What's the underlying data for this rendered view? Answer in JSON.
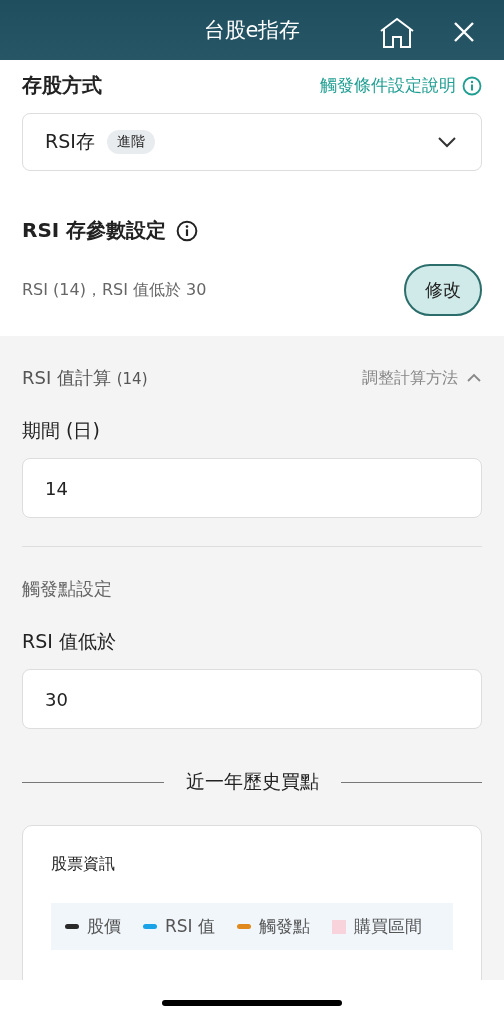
{
  "header": {
    "title": "台股e指存"
  },
  "method": {
    "label": "存股方式",
    "help_link": "觸發條件設定說明",
    "value": "RSI存",
    "badge": "進階"
  },
  "params": {
    "title": "RSI 存參數設定",
    "summary": "RSI (14)，RSI 值低於 30",
    "edit_button": "修改"
  },
  "calc": {
    "title": "RSI 值計算",
    "count": "(14)",
    "toggle": "調整計算方法",
    "expanded": true,
    "period_label": "期間 (日)",
    "period_value": "14",
    "trigger_title": "觸發點設定",
    "threshold_label": "RSI 值低於",
    "threshold_value": "30"
  },
  "history": {
    "title": "近一年歷史買點",
    "card_title": "股票資訊",
    "legend": [
      {
        "label": "股價",
        "kind": "line",
        "color": "#2a2a2a"
      },
      {
        "label": "RSI 值",
        "kind": "line",
        "color": "#1aa3e8"
      },
      {
        "label": "觸發點",
        "kind": "line",
        "color": "#e08a1e"
      },
      {
        "label": "購買區間",
        "kind": "area",
        "color": "#f9d3dc"
      }
    ]
  }
}
